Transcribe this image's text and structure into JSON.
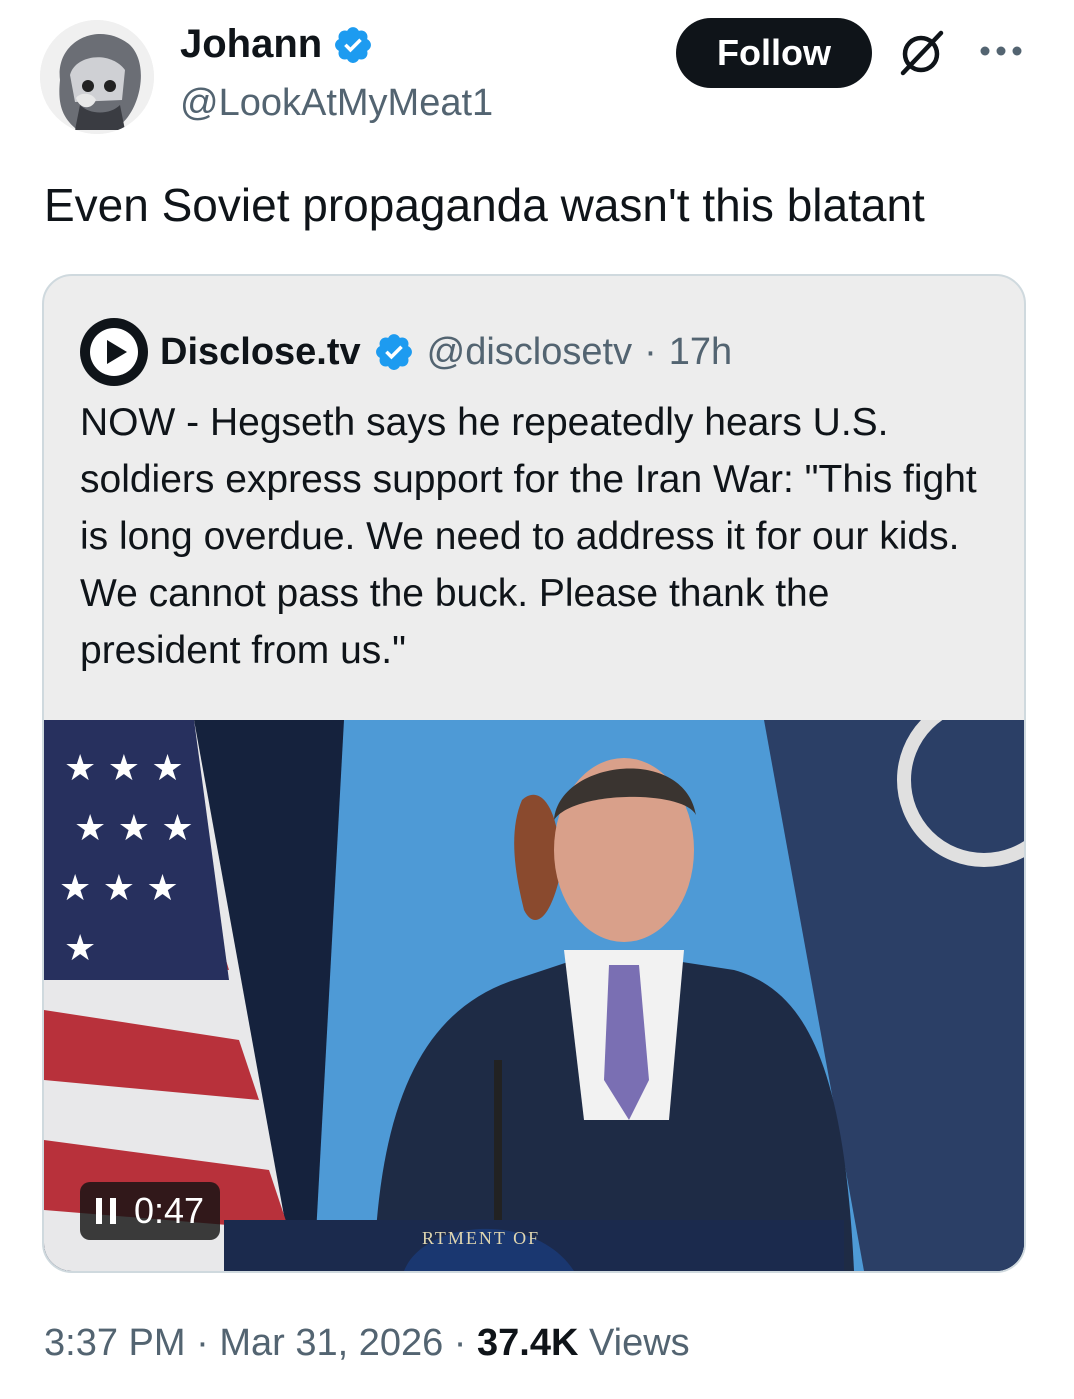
{
  "author": {
    "name": "Johann",
    "handle": "@LookAtMyMeat1",
    "avatar_icon": "anime-avatar-icon",
    "verified_icon": "verified-badge-icon"
  },
  "actions": {
    "follow_label": "Follow",
    "grok_icon": "grok-icon",
    "more_icon": "more-icon"
  },
  "tweet": {
    "text": "Even Soviet propaganda wasn't this blatant"
  },
  "quote": {
    "name": "Disclose.tv",
    "handle": "@disclosetv",
    "separator": "·",
    "time": "17h",
    "text": "NOW - Hegseth says he repeatedly hears U.S. soldiers express support for the Iran War: \"This fight is long overdue. We need to address it for our kids. We cannot pass the buck. Please thank the president from us.\"",
    "video": {
      "time": "0:47",
      "podium_text": "RTMENT OF"
    }
  },
  "meta": {
    "time": "3:37 PM",
    "sep1": "·",
    "date": "Mar 31, 2026",
    "sep2": "·",
    "views_count": "37.4K",
    "views_label": "Views"
  },
  "colors": {
    "text_primary": "#0f1419",
    "text_secondary": "#536471",
    "verified": "#1d9bf0",
    "quote_bg": "#ededed",
    "border": "#cfd9de"
  }
}
